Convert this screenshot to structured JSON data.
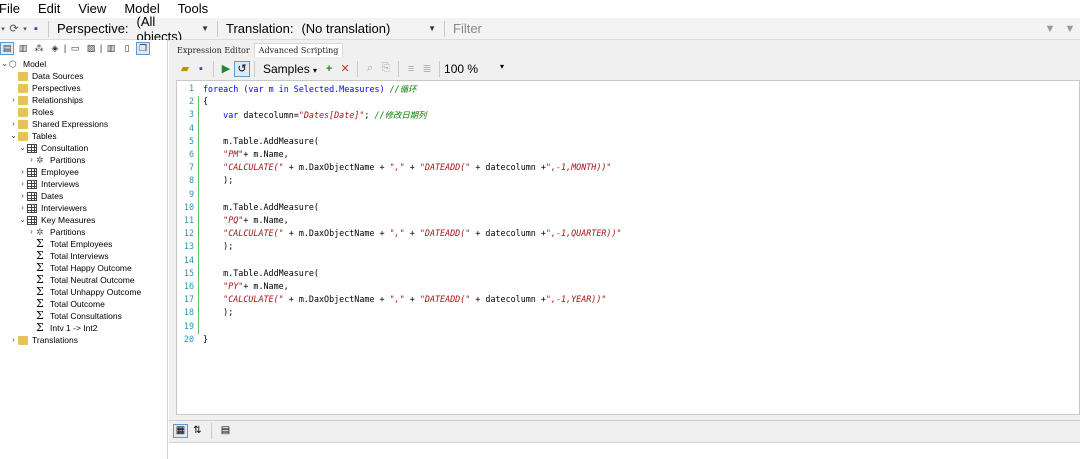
{
  "menu": [
    "File",
    "Edit",
    "View",
    "Model",
    "Tools"
  ],
  "toolbar": {
    "perspective_label": "Perspective:",
    "perspective_value": "(All objects)",
    "translation_label": "Translation:",
    "translation_value": "(No translation)",
    "filter_placeholder": "Filter"
  },
  "tree": {
    "items": [
      {
        "label": "Model",
        "icon": "model-icon",
        "indent": 0,
        "chev": "⌄"
      },
      {
        "label": "Data Sources",
        "icon": "folder-icon",
        "indent": 1,
        "chev": ""
      },
      {
        "label": "Perspectives",
        "icon": "folder-icon",
        "indent": 1,
        "chev": ""
      },
      {
        "label": "Relationships",
        "icon": "folder-icon",
        "indent": 1,
        "chev": "›"
      },
      {
        "label": "Roles",
        "icon": "folder-icon",
        "indent": 1,
        "chev": ""
      },
      {
        "label": "Shared Expressions",
        "icon": "folder-icon",
        "indent": 1,
        "chev": "›"
      },
      {
        "label": "Tables",
        "icon": "folder-icon",
        "indent": 1,
        "chev": "⌄"
      },
      {
        "label": "Consultation",
        "icon": "table-icon",
        "indent": 2,
        "chev": "⌄"
      },
      {
        "label": "Partitions",
        "icon": "partitions-icon",
        "indent": 3,
        "chev": "›"
      },
      {
        "label": "Employee",
        "icon": "table-icon",
        "indent": 2,
        "chev": "›"
      },
      {
        "label": "Interviews",
        "icon": "table-icon",
        "indent": 2,
        "chev": "›"
      },
      {
        "label": "Dates",
        "icon": "table-icon",
        "indent": 2,
        "chev": "›"
      },
      {
        "label": "Interviewers",
        "icon": "table-icon",
        "indent": 2,
        "chev": "›"
      },
      {
        "label": "Key Measures",
        "icon": "table-icon",
        "indent": 2,
        "chev": "⌄"
      },
      {
        "label": "Partitions",
        "icon": "partitions-icon",
        "indent": 3,
        "chev": "›"
      },
      {
        "label": "Total Employees",
        "icon": "measure-icon",
        "indent": 3,
        "chev": ""
      },
      {
        "label": "Total Interviews",
        "icon": "measure-icon",
        "indent": 3,
        "chev": ""
      },
      {
        "label": "Total Happy Outcome",
        "icon": "measure-icon",
        "indent": 3,
        "chev": ""
      },
      {
        "label": "Total Neutral Outcome",
        "icon": "measure-icon",
        "indent": 3,
        "chev": ""
      },
      {
        "label": "Total Unhappy Outcome",
        "icon": "measure-icon",
        "indent": 3,
        "chev": ""
      },
      {
        "label": "Total Outcome",
        "icon": "measure-icon",
        "indent": 3,
        "chev": ""
      },
      {
        "label": "Total Consultations",
        "icon": "measure-icon",
        "indent": 3,
        "chev": ""
      },
      {
        "label": "Intv 1 -> Int2",
        "icon": "measure-icon",
        "indent": 3,
        "chev": ""
      },
      {
        "label": "Translations",
        "icon": "folder-icon",
        "indent": 1,
        "chev": "›"
      }
    ]
  },
  "editor": {
    "tabs": [
      "Expression Editor",
      "Advanced Scripting"
    ],
    "active_tab": "Advanced Scripting",
    "samples_label": "Samples",
    "zoom": "100 %",
    "line_numbers": [
      "1",
      "2",
      "3",
      "4",
      "5",
      "6",
      "7",
      "8",
      "9",
      "10",
      "11",
      "12",
      "13",
      "14",
      "15",
      "16",
      "17",
      "18",
      "19",
      "20"
    ],
    "code_lines": [
      [
        {
          "t": "foreach (",
          "c": "kw"
        },
        {
          "t": "var",
          "c": "kw"
        },
        {
          "t": " m ",
          "c": "kw"
        },
        {
          "t": "in",
          "c": "kw"
        },
        {
          "t": " Selected.Measures) ",
          "c": "kw"
        },
        {
          "t": "//循环",
          "c": "cm"
        }
      ],
      [
        {
          "t": "{",
          "c": ""
        }
      ],
      [
        {
          "t": "    ",
          "c": ""
        },
        {
          "t": "var",
          "c": "kw"
        },
        {
          "t": " datecolumn=",
          "c": ""
        },
        {
          "t": "\"Dates[Date]\"",
          "c": "str"
        },
        {
          "t": "; ",
          "c": ""
        },
        {
          "t": "//修改日期列",
          "c": "cm"
        }
      ],
      [
        {
          "t": "",
          "c": ""
        }
      ],
      [
        {
          "t": "    m.Table.AddMeasure(",
          "c": ""
        }
      ],
      [
        {
          "t": "    ",
          "c": ""
        },
        {
          "t": "\"PM\"",
          "c": "str"
        },
        {
          "t": "+ m.Name,",
          "c": ""
        }
      ],
      [
        {
          "t": "    ",
          "c": ""
        },
        {
          "t": "\"CALCULATE(\"",
          "c": "str"
        },
        {
          "t": " + m.DaxObjectName + ",
          "c": ""
        },
        {
          "t": "\",\"",
          "c": "str"
        },
        {
          "t": " + ",
          "c": ""
        },
        {
          "t": "\"DATEADD(\"",
          "c": "str"
        },
        {
          "t": " + datecolumn +",
          "c": ""
        },
        {
          "t": "\",-1,MONTH))\"",
          "c": "str"
        }
      ],
      [
        {
          "t": "    );",
          "c": ""
        }
      ],
      [
        {
          "t": "",
          "c": ""
        }
      ],
      [
        {
          "t": "    m.Table.AddMeasure(",
          "c": ""
        }
      ],
      [
        {
          "t": "    ",
          "c": ""
        },
        {
          "t": "\"PQ\"",
          "c": "str"
        },
        {
          "t": "+ m.Name,",
          "c": ""
        }
      ],
      [
        {
          "t": "    ",
          "c": ""
        },
        {
          "t": "\"CALCULATE(\"",
          "c": "str"
        },
        {
          "t": " + m.DaxObjectName + ",
          "c": ""
        },
        {
          "t": "\",\"",
          "c": "str"
        },
        {
          "t": " + ",
          "c": ""
        },
        {
          "t": "\"DATEADD(\"",
          "c": "str"
        },
        {
          "t": " + datecolumn +",
          "c": ""
        },
        {
          "t": "\",-1,QUARTER))\"",
          "c": "str"
        }
      ],
      [
        {
          "t": "    );",
          "c": ""
        }
      ],
      [
        {
          "t": "",
          "c": ""
        }
      ],
      [
        {
          "t": "    m.Table.AddMeasure(",
          "c": ""
        }
      ],
      [
        {
          "t": "    ",
          "c": ""
        },
        {
          "t": "\"PY\"",
          "c": "str"
        },
        {
          "t": "+ m.Name,",
          "c": ""
        }
      ],
      [
        {
          "t": "    ",
          "c": ""
        },
        {
          "t": "\"CALCULATE(\"",
          "c": "str"
        },
        {
          "t": " + m.DaxObjectName + ",
          "c": ""
        },
        {
          "t": "\",\"",
          "c": "str"
        },
        {
          "t": " + ",
          "c": ""
        },
        {
          "t": "\"DATEADD(\"",
          "c": "str"
        },
        {
          "t": " + datecolumn +",
          "c": ""
        },
        {
          "t": "\",-1,YEAR))\"",
          "c": "str"
        }
      ],
      [
        {
          "t": "    );",
          "c": ""
        }
      ],
      [
        {
          "t": "",
          "c": ""
        }
      ],
      [
        {
          "t": "}",
          "c": ""
        }
      ]
    ]
  },
  "colors": {
    "keyword": "#0000ff",
    "string": "#a31515",
    "comment": "#008000",
    "line_number": "#2b91af",
    "change_bar": "#6abf69"
  }
}
